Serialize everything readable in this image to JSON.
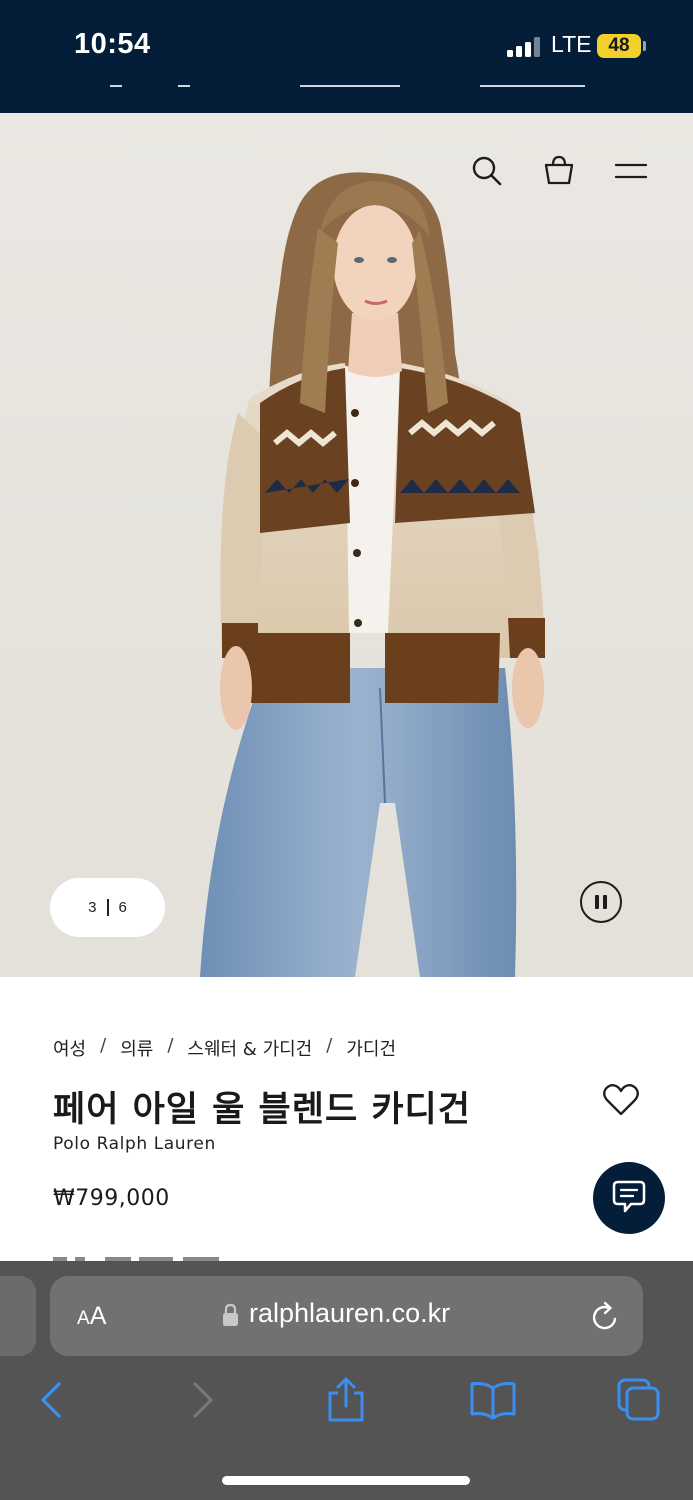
{
  "status_bar": {
    "time": "10:54",
    "network": "LTE",
    "battery": "48"
  },
  "header": {
    "icons": [
      "search-icon",
      "shopping-bag-icon",
      "menu-icon"
    ]
  },
  "gallery": {
    "current": "3",
    "total": "6",
    "pause_icon": "pause-icon"
  },
  "product": {
    "breadcrumb": [
      "여성",
      "의류",
      "스웨터 & 가디건",
      "가디건"
    ],
    "breadcrumb_separator": "/",
    "title": "페어 아일 울 블렌드 카디건",
    "brand": "Polo Ralph Lauren",
    "price": "₩799,000",
    "wishlist_icon": "heart-icon",
    "chat_icon": "chat-icon"
  },
  "browser": {
    "text_size_label_small": "A",
    "text_size_label_large": "A",
    "url": "ralphlauren.co.kr",
    "toolbar_icons": [
      "back-icon",
      "forward-icon",
      "share-icon",
      "bookmarks-icon",
      "tabs-icon"
    ]
  },
  "colors": {
    "navy": "#041e3a",
    "battery": "#f2cf2a",
    "safari_bar": "#545454",
    "safari_blue": "#3a8ff0"
  }
}
